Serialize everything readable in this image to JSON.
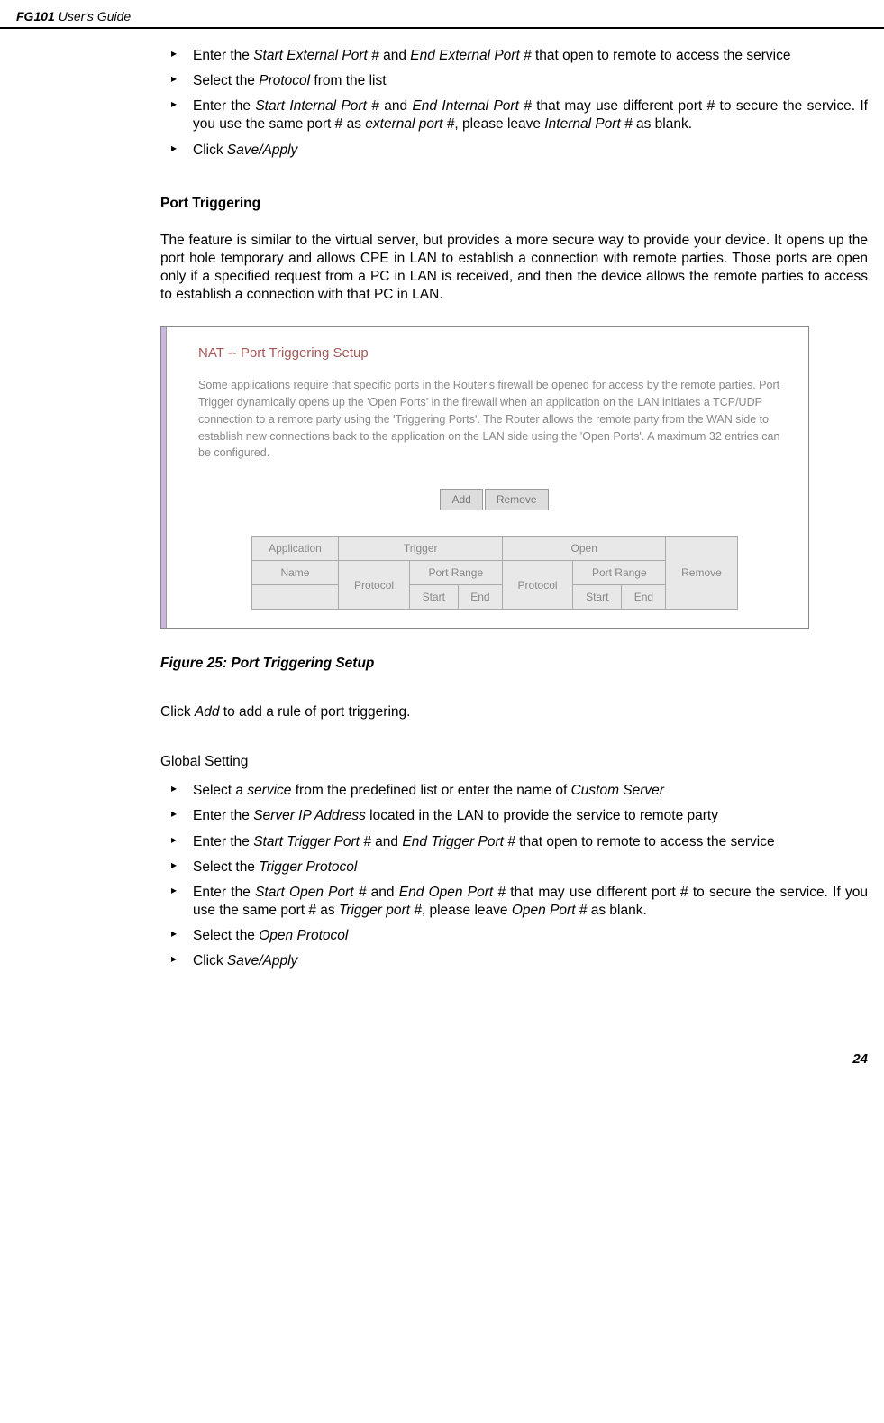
{
  "header": {
    "boldPart": "FG101",
    "regularPart": " User's Guide"
  },
  "topBullets": [
    {
      "prefix": "Enter the ",
      "italic1": "Start External Port #",
      "mid": " and ",
      "italic2": "End External Port #",
      "suffix": " that open to remote to access the service"
    },
    {
      "prefix": "Select the ",
      "italic1": "Protocol",
      "suffix": " from the list"
    },
    {
      "prefix": "Enter the ",
      "italic1": "Start Internal Port #",
      "mid": " and ",
      "italic2": "End Internal Port #",
      "suffix1": " that may use different port # to secure the service. If you use the same port # as ",
      "italic3": "external port #",
      "suffix2": ", please leave ",
      "italic4": "Internal Port #",
      "suffix3": " as blank."
    },
    {
      "prefix": "Click ",
      "italic1": "Save/Apply"
    }
  ],
  "sectionHeading": "Port Triggering",
  "paragraph": "The feature is similar to the virtual server, but provides a more secure way to provide your device. It opens up the port hole temporary and allows CPE in LAN to establish a connection with remote parties. Those ports are open only if a specified request from a PC in LAN is received, and then the device allows the remote parties to access to establish a connection with that PC in LAN.",
  "figure": {
    "title": "NAT -- Port Triggering Setup",
    "description": "Some applications require that specific ports in the Router's firewall be opened for access by the remote parties. Port Trigger dynamically opens up the 'Open Ports' in the firewall when an application on the LAN initiates a TCP/UDP connection to a remote party using the 'Triggering Ports'. The Router allows the remote party from the WAN side to establish new connections back to the application on the LAN side using the 'Open Ports'. A maximum 32 entries can be configured.",
    "addBtn": "Add",
    "removeBtn": "Remove",
    "table": {
      "headers": {
        "application": "Application",
        "trigger": "Trigger",
        "open": "Open",
        "remove": "Remove",
        "name": "Name",
        "protocol": "Protocol",
        "portRange": "Port Range",
        "start": "Start",
        "end": "End"
      }
    }
  },
  "figureCaption": "Figure 25: Port Triggering Setup",
  "clickAdd": {
    "prefix": "Click ",
    "italic": "Add",
    "suffix": " to add a rule of port triggering."
  },
  "globalSetting": "Global Setting",
  "bottomBullets": [
    {
      "prefix": "Select a ",
      "italic1": "service",
      "mid": " from the predefined list or enter the name of ",
      "italic2": "Custom Server"
    },
    {
      "prefix": "Enter the ",
      "italic1": "Server IP Address",
      "suffix": " located in the LAN to provide the service to remote party"
    },
    {
      "prefix": "Enter the ",
      "italic1": "Start Trigger Port #",
      "mid": " and ",
      "italic2": "End Trigger Port #",
      "suffix": " that open to remote to access the service"
    },
    {
      "prefix": "Select the ",
      "italic1": "Trigger Protocol"
    },
    {
      "prefix": "Enter the ",
      "italic1": "Start Open Port #",
      "mid": " and ",
      "italic2": "End Open Port #",
      "suffix1": " that may use different port # to secure the service. If you use the same port # as ",
      "italic3": "Trigger port #",
      "suffix2": ", please leave ",
      "italic4": "Open Port #",
      "suffix3": " as blank."
    },
    {
      "prefix": "Select the ",
      "italic1": "Open Protocol"
    },
    {
      "prefix": "Click ",
      "italic1": "Save/Apply"
    }
  ],
  "pageNumber": "24"
}
